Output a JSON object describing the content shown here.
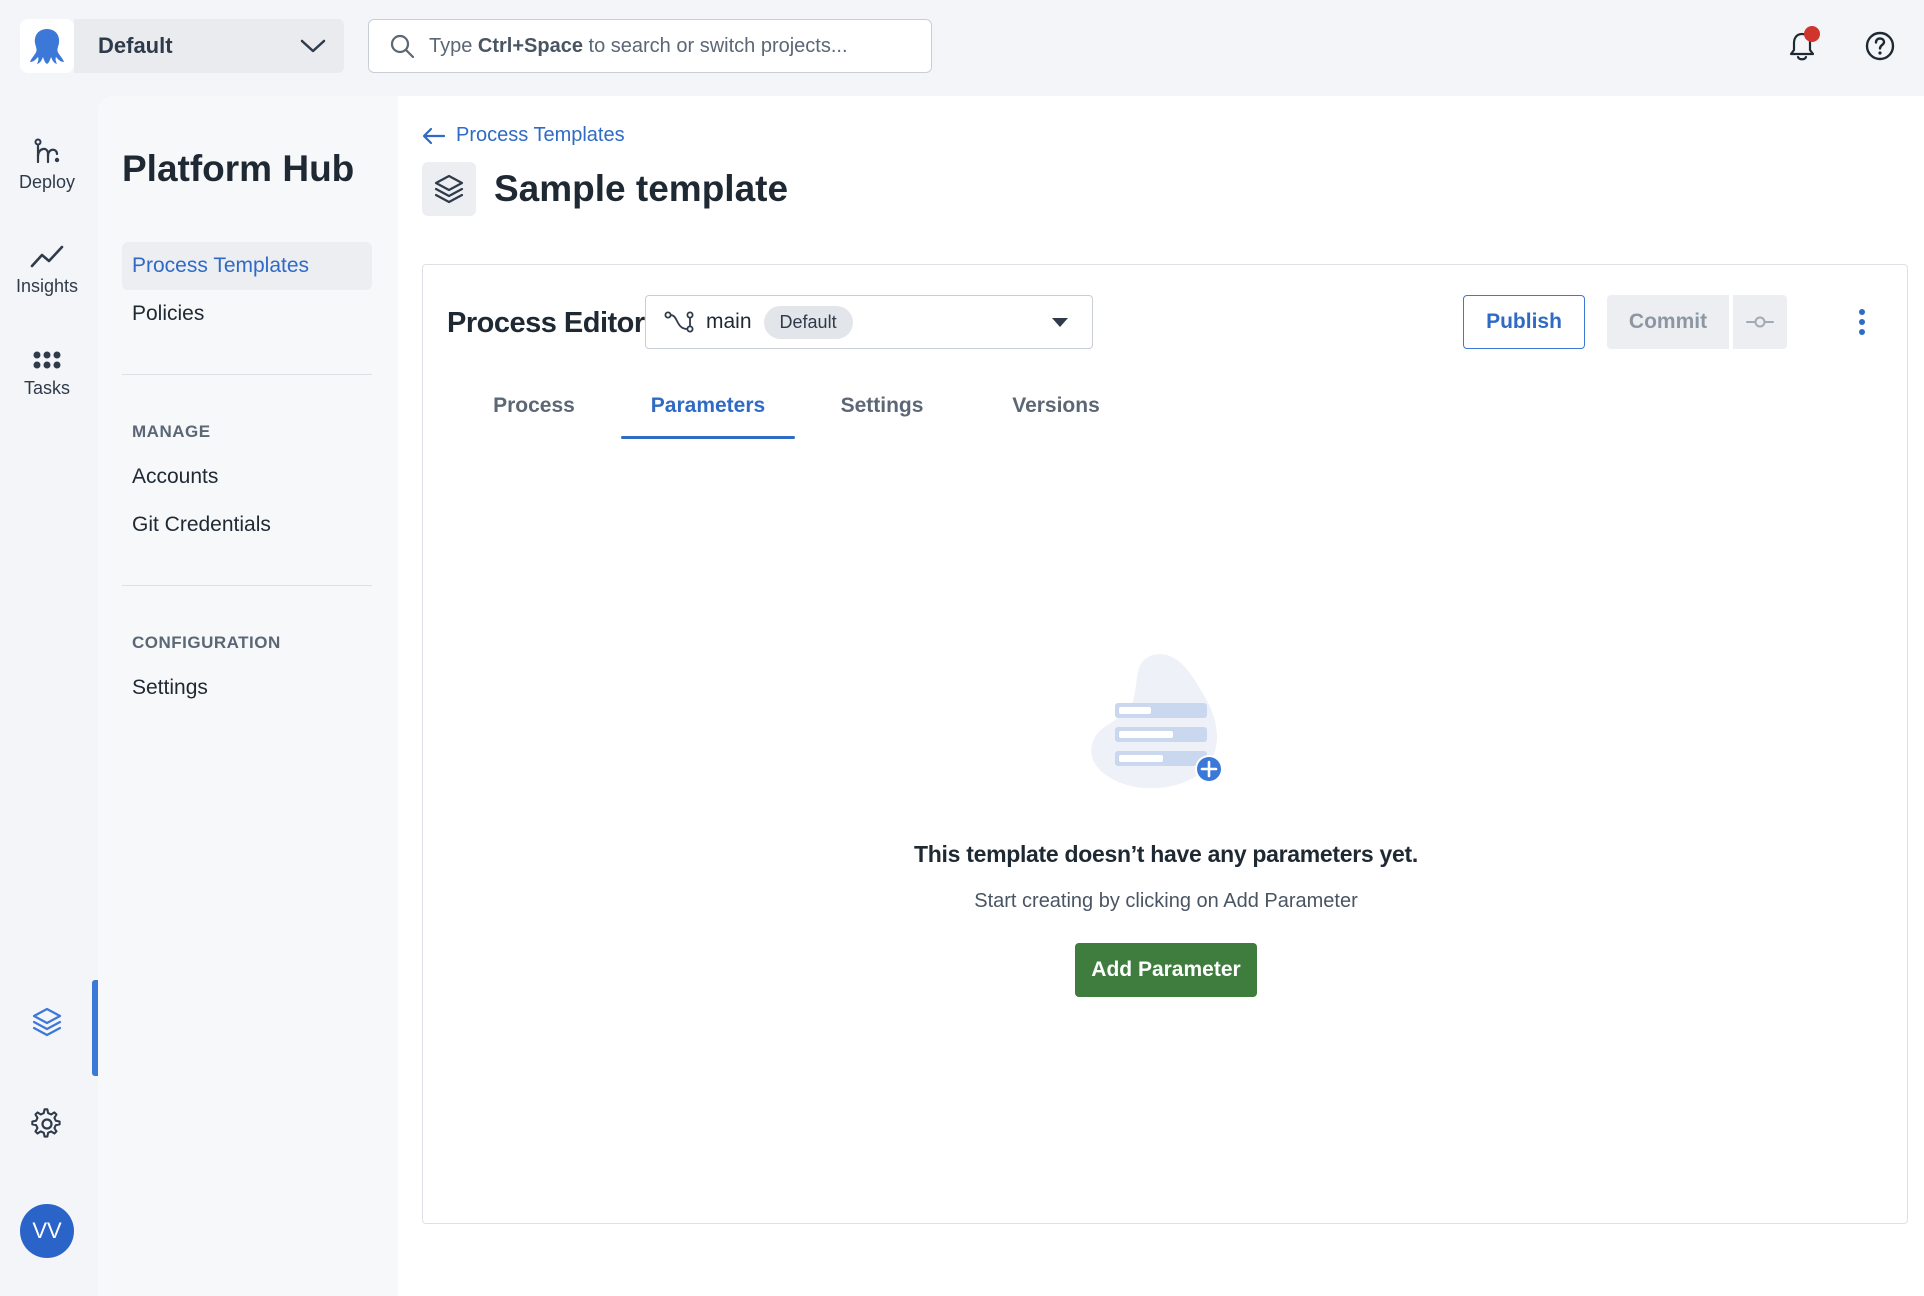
{
  "topbar": {
    "space_name": "Default",
    "search_placeholder_prefix": "Type ",
    "search_placeholder_key": "Ctrl+Space",
    "search_placeholder_suffix": " to search or switch projects..."
  },
  "rail": {
    "deploy": "Deploy",
    "insights": "Insights",
    "tasks": "Tasks",
    "avatar_initials": "VV"
  },
  "sidebar": {
    "title": "Platform Hub",
    "items": [
      {
        "label": "Process Templates",
        "active": true
      },
      {
        "label": "Policies",
        "active": false
      }
    ],
    "manage_heading": "MANAGE",
    "manage_items": [
      {
        "label": "Accounts"
      },
      {
        "label": "Git Credentials"
      }
    ],
    "config_heading": "CONFIGURATION",
    "config_items": [
      {
        "label": "Settings"
      }
    ]
  },
  "main": {
    "breadcrumb": "Process Templates",
    "title": "Sample template",
    "editor": {
      "title": "Process Editor",
      "branch_name": "main",
      "branch_badge": "Default",
      "publish_label": "Publish",
      "commit_label": "Commit"
    },
    "tabs": [
      {
        "label": "Process",
        "active": false
      },
      {
        "label": "Parameters",
        "active": true
      },
      {
        "label": "Settings",
        "active": false
      },
      {
        "label": "Versions",
        "active": false
      }
    ],
    "empty_state": {
      "title": "This template doesn’t have any parameters yet.",
      "subtitle": "Start creating by clicking on Add Parameter",
      "button": "Add Parameter"
    }
  },
  "colors": {
    "accent": "#2f6bc4",
    "primary_button": "#3f7d3f",
    "notification": "#d0342c",
    "avatar": "#2a64c9"
  }
}
